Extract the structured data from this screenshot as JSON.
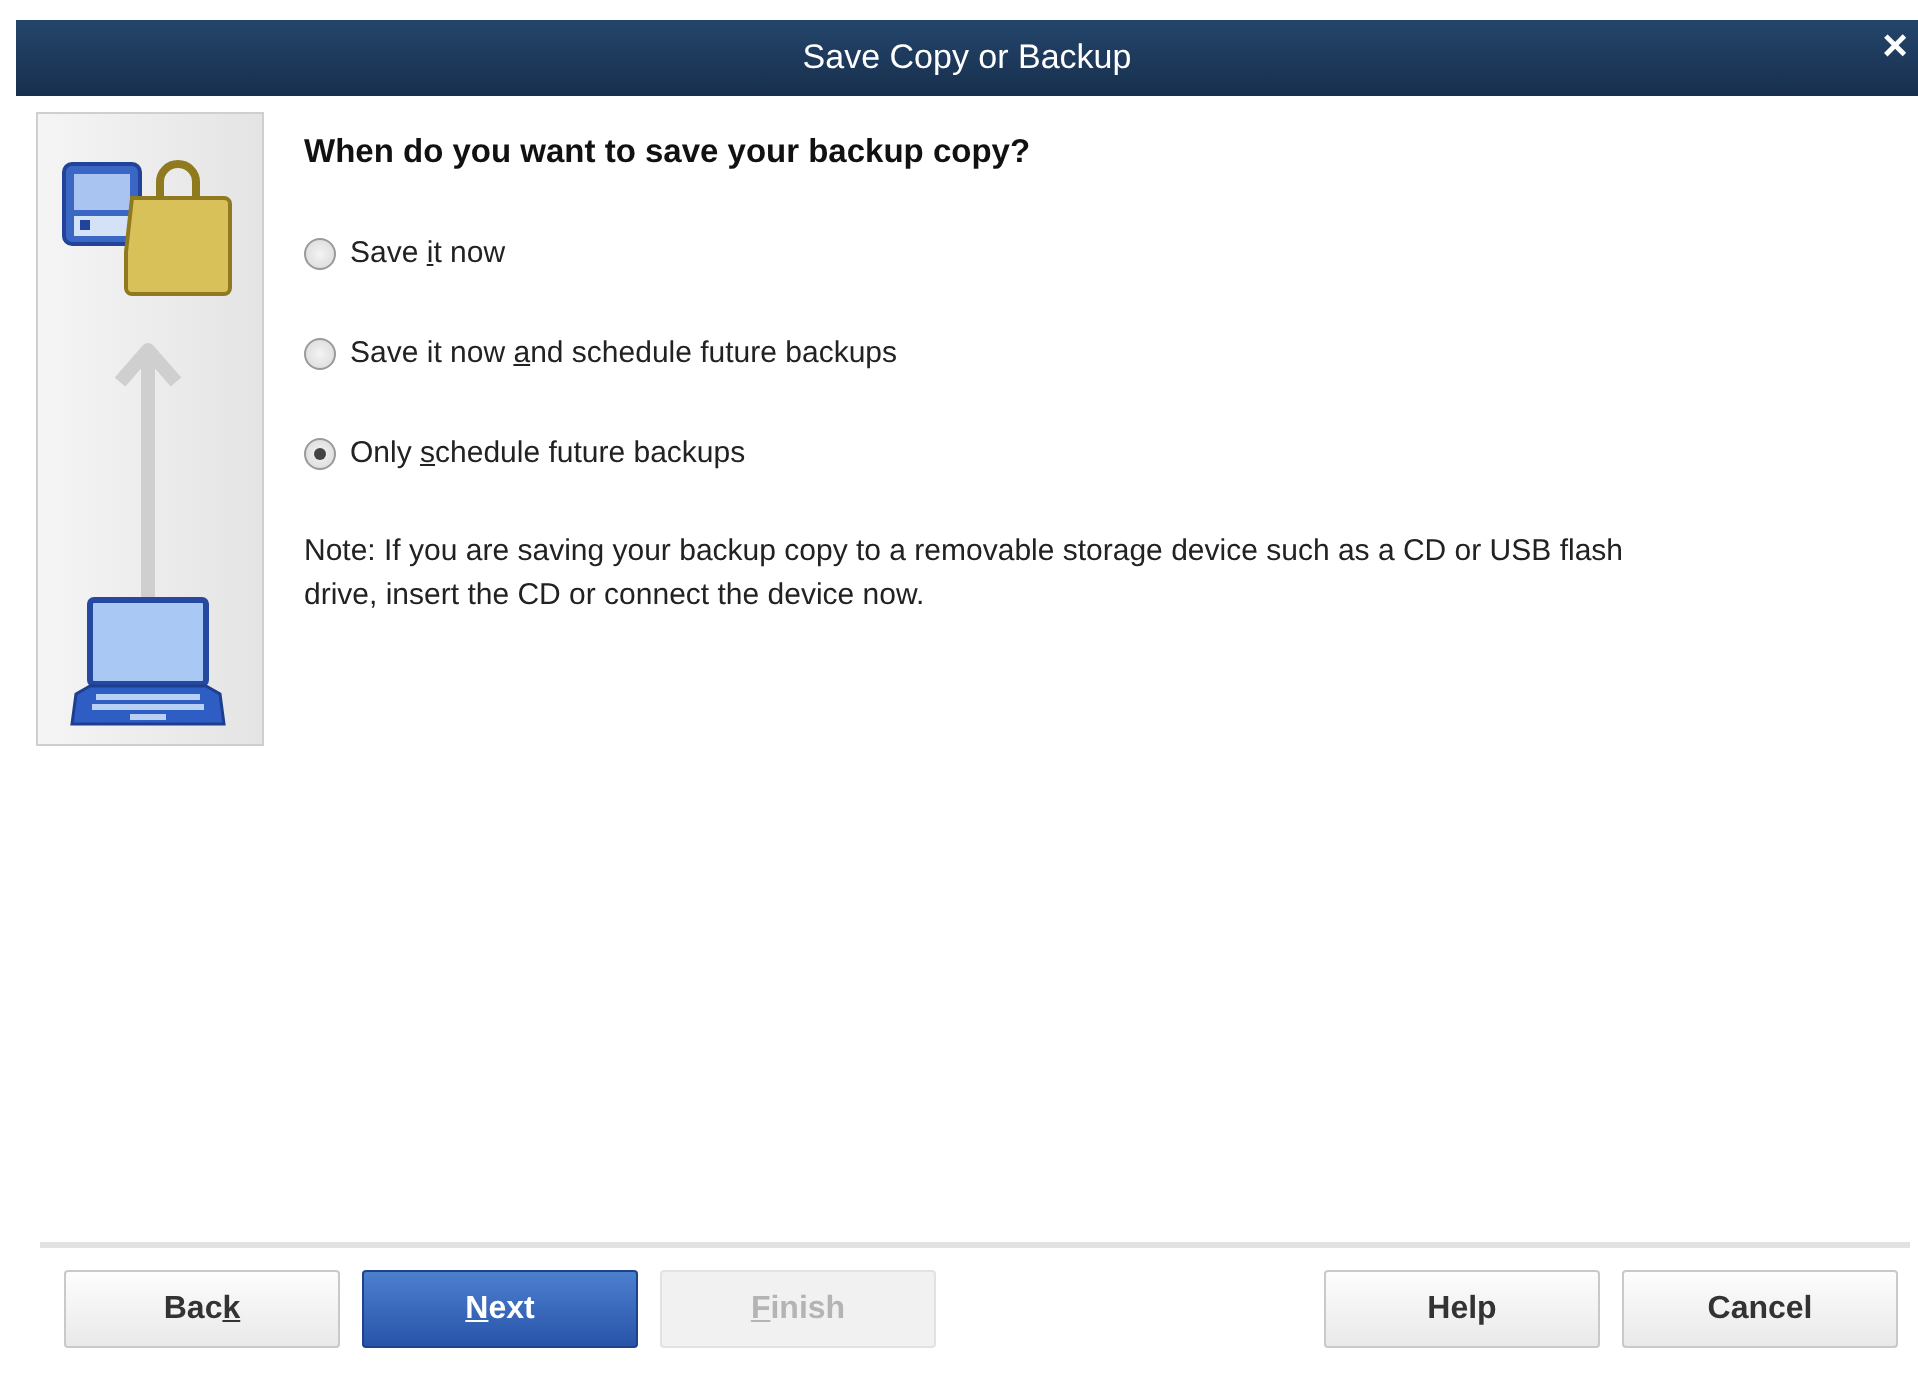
{
  "window": {
    "title": "Save Copy or Backup",
    "close": "×"
  },
  "question": "When do you want to save your backup copy?",
  "options": [
    {
      "label_parts": [
        {
          "text": "Save ",
          "access_key": false
        },
        {
          "text": "i",
          "access_key": true
        },
        {
          "text": "t now",
          "access_key": false
        }
      ],
      "selected": false
    },
    {
      "label_parts": [
        {
          "text": "Save it now ",
          "access_key": false
        },
        {
          "text": "a",
          "access_key": true
        },
        {
          "text": "nd schedule future backups",
          "access_key": false
        }
      ],
      "selected": false
    },
    {
      "label_parts": [
        {
          "text": "Only ",
          "access_key": false
        },
        {
          "text": "s",
          "access_key": true
        },
        {
          "text": "chedule future backups",
          "access_key": false
        }
      ],
      "selected": true
    }
  ],
  "note": "Note: If you are saving your backup copy to a removable storage device such as a CD or USB flash drive, insert the CD or connect the device now.",
  "buttons": [
    {
      "label_parts": [
        {
          "text": "Bac",
          "access_key": false
        },
        {
          "text": "k",
          "access_key": true
        }
      ],
      "kind": "default",
      "disabled": false,
      "pushed_right": false
    },
    {
      "label_parts": [
        {
          "text": "N",
          "access_key": true
        },
        {
          "text": "ext",
          "access_key": false
        }
      ],
      "kind": "primary",
      "disabled": false,
      "pushed_right": false
    },
    {
      "label_parts": [
        {
          "text": "F",
          "access_key": true
        },
        {
          "text": "inish",
          "access_key": false
        }
      ],
      "kind": "default",
      "disabled": true,
      "pushed_right": false
    },
    {
      "label_parts": [
        {
          "text": "Help",
          "access_key": false
        }
      ],
      "kind": "default",
      "disabled": false,
      "pushed_right": true
    },
    {
      "label_parts": [
        {
          "text": "Cancel",
          "access_key": false
        }
      ],
      "kind": "default",
      "disabled": false,
      "pushed_right": false
    }
  ]
}
